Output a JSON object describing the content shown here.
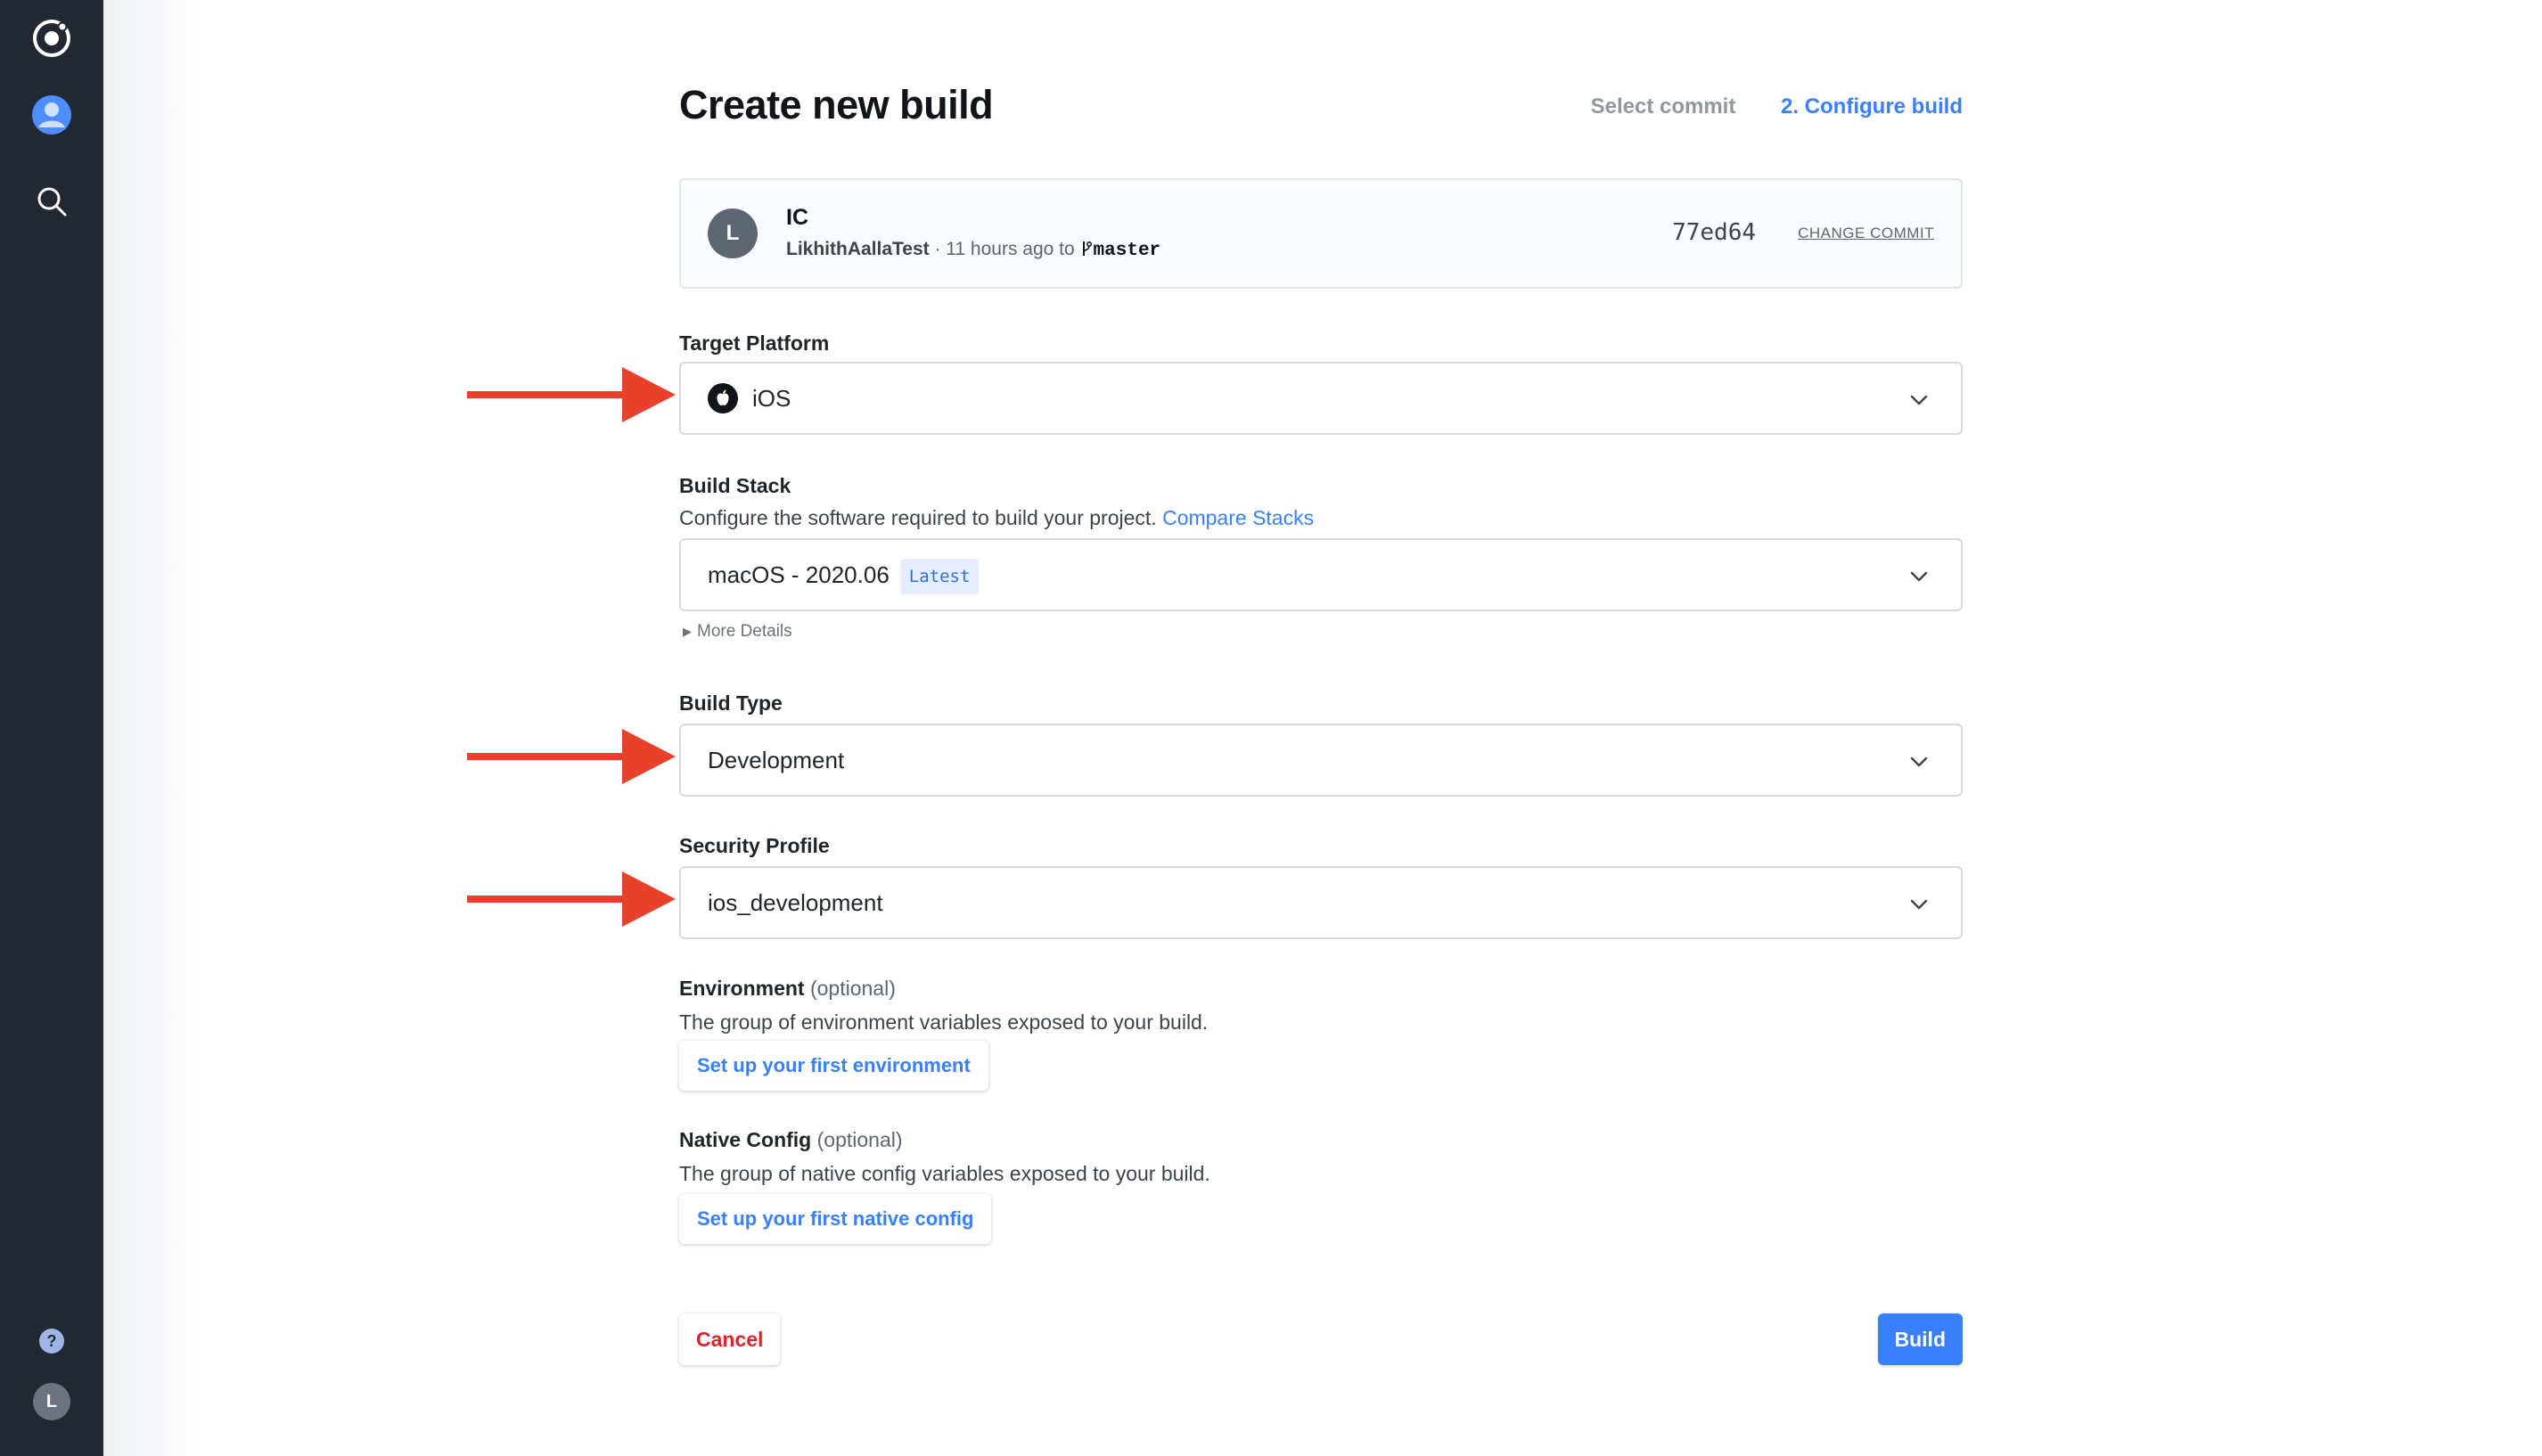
{
  "page": {
    "title": "Create new build",
    "steps": [
      "Select commit",
      "2. Configure build"
    ]
  },
  "commit": {
    "avatar_initial": "L",
    "message": "IC",
    "author": "LikhithAallaTest",
    "meta": " · 11 hours ago to ",
    "branch_icon": "branch-icon",
    "branch": "master",
    "hash": "77ed64",
    "change_label": "CHANGE COMMIT"
  },
  "target_platform": {
    "label": "Target Platform",
    "value": "iOS",
    "icon": "apple-icon"
  },
  "build_stack": {
    "label": "Build Stack",
    "help": "Configure the software required to build your project.",
    "help_link": "Compare Stacks",
    "value": "macOS - 2020.06",
    "badge": "Latest",
    "more_details": "More Details"
  },
  "build_type": {
    "label": "Build Type",
    "value": "Development"
  },
  "security_profile": {
    "label": "Security Profile",
    "value": "ios_development"
  },
  "environment": {
    "label": "Environment",
    "optional": "(optional)",
    "help": "The group of environment variables exposed to your build.",
    "button": "Set up your first environment"
  },
  "native_config": {
    "label": "Native Config",
    "optional": "(optional)",
    "help": "The group of native config variables exposed to your build.",
    "button": "Set up your first native config"
  },
  "actions": {
    "cancel": "Cancel",
    "build": "Build"
  },
  "sidebar": {
    "user_initial": "L",
    "icons": [
      "logo-icon",
      "profile-icon",
      "search-icon",
      "help-icon",
      "user-avatar"
    ]
  },
  "colors": {
    "accent": "#3880ff",
    "danger": "#d9262c",
    "sidebar": "#222831",
    "annotation_arrow": "#e8402b"
  }
}
